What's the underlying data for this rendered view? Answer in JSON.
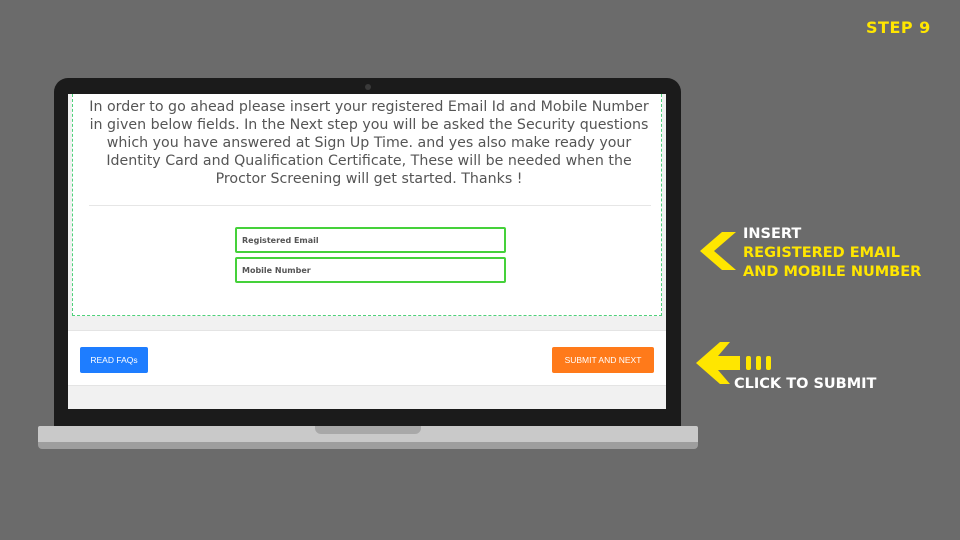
{
  "step_label": "STEP 9",
  "form": {
    "instructions": "In order to go ahead please insert your registered Email Id and Mobile Number in given below fields. In the Next step you will be asked the Security questions which you have answered at Sign Up Time. and yes also make ready your Identity Card and Qualification Certificate, These will be needed when the Proctor Screening will get started. Thanks !",
    "email_placeholder": "Registered Email",
    "mobile_placeholder": "Mobile Number",
    "email_value": "",
    "mobile_value": ""
  },
  "footer": {
    "faq_label": "READ FAQs",
    "submit_label": "SUBMIT AND NEXT"
  },
  "annotations": {
    "insert_line1": "INSERT",
    "insert_line2": "REGISTERED EMAIL",
    "insert_line3": "AND MOBILE NUMBER",
    "submit_hint": "CLICK TO SUBMIT",
    "chevron_icon": "chevron-left-icon",
    "arrow_icon": "arrow-left-icon"
  },
  "colors": {
    "background": "#6b6b6b",
    "highlight_yellow": "#ffe600",
    "field_border_green": "#45d13a",
    "faq_blue": "#1e7dff",
    "submit_orange": "#ff7a1a"
  }
}
